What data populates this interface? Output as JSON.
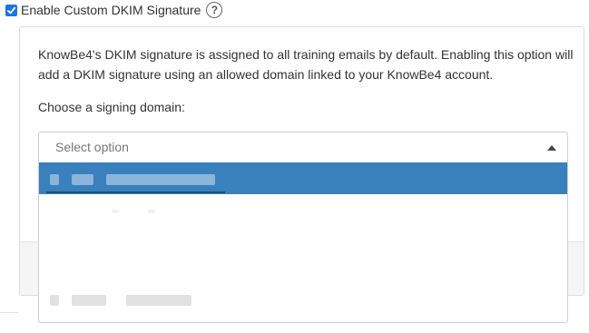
{
  "header": {
    "checkbox_checked": true,
    "label": "Enable Custom DKIM Signature",
    "help_glyph": "?"
  },
  "panel": {
    "description": "KnowBe4's DKIM signature is assigned to all training emails by default. Enabling this option will add a DKIM signature using an allowed domain linked to your KnowBe4 account.",
    "choose_label": "Choose a signing domain:"
  },
  "select": {
    "placeholder": "Select option",
    "expanded": true
  },
  "dropdown": {
    "options_redacted": true,
    "highlight_color": "#3a80bd"
  },
  "colors": {
    "accent": "#1a73e8",
    "highlight": "#3a80bd"
  }
}
